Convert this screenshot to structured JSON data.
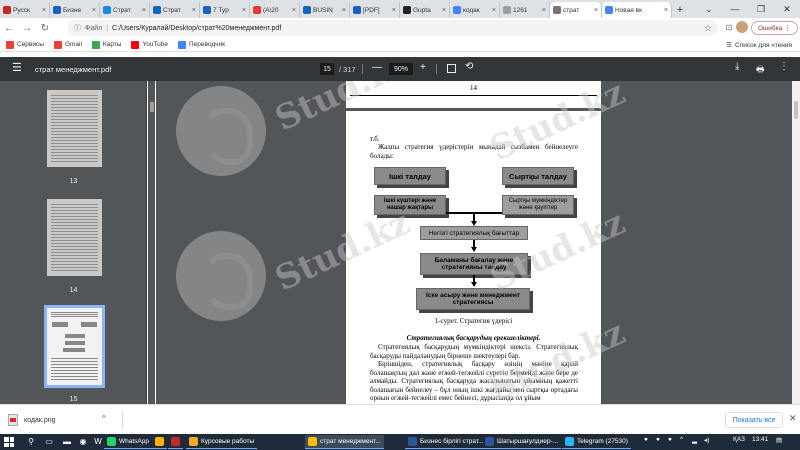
{
  "browser": {
    "tabs": [
      {
        "label": "Русск",
        "color": "#c62828"
      },
      {
        "label": "Бизне",
        "color": "#1565c0"
      },
      {
        "label": "Страт",
        "color": "#1e88e5"
      },
      {
        "label": "Страт",
        "color": "#1565c0"
      },
      {
        "label": "7 Тур",
        "color": "#1565c0"
      },
      {
        "label": "(А\\20",
        "color": "#e53935"
      },
      {
        "label": "BUSIN",
        "color": "#1565c0"
      },
      {
        "label": "[PDF]",
        "color": "#1565c0"
      },
      {
        "label": "Gupta",
        "color": "#212121"
      },
      {
        "label": "кодак",
        "color": "#4285f4"
      },
      {
        "label": "1261",
        "color": "#9e9e9e"
      }
    ],
    "active_tab": {
      "label": "страт",
      "color": "#757575"
    },
    "new_tab": {
      "label": "Новая вк",
      "color": "#4285f4"
    },
    "address": {
      "scheme_label": "Файл",
      "url": "C:/Users/Куралай/Desktop/страт%20менеджмент.pdf"
    },
    "error_label": "Ошибка",
    "bookmarks": [
      {
        "label": "Сервисы",
        "color": "#ea4335"
      },
      {
        "label": "Gmail",
        "color": "#ea4335"
      },
      {
        "label": "Карты",
        "color": "#34a853"
      },
      {
        "label": "YouTube",
        "color": "#ff0000"
      },
      {
        "label": "Переводчик",
        "color": "#4285f4"
      }
    ],
    "reading_list": "Список для чтения"
  },
  "pdf": {
    "title": "страт менеджмент.pdf",
    "current_page": "15",
    "total_pages": "/ 317",
    "zoom": "90%",
    "thumbnails": [
      {
        "num": "13"
      },
      {
        "num": "14"
      },
      {
        "num": "15"
      }
    ],
    "prev_page_number": "14",
    "page": {
      "ref": "т.б.",
      "intro": "Жалпы стратегия үдерістерін мынадай сызбамен бейнелеуге болады:",
      "boxes": {
        "internal": "Ішкі талдау",
        "external": "Сыртқы талдау",
        "strengths": "Ішкі күштері және нашар жақтары",
        "opportunities": "Сыртқы мүмкіндіктер және қауіптер",
        "basis": "Негізгі стратегиялық бағыттар",
        "evaluation": "Баламаны бағалау және стратегияны таңдау",
        "implementation": "Іске асыру және менеджмент стратегиясы"
      },
      "caption": "1-сурет.  Стратегия үдерісі",
      "heading": "Стратегиялық басқарудың ерекшеліктері.",
      "para1": "Стратегиялық басқарудың мүмкіндіктері шексіз. Стратегиялық басқаруды пайдаланудың бірнеше шектеулері бар.",
      "para2": "Біріншіден, стратегиялық басқару өзінің мәніне қарай болашақтың дәл және егжей-тегжейлі суретін бермейді және бере де алмайды. Стратегиялық басқаруда жасалынатын ұйымның қажетті болашағын бейнелеу – бұл оның ішкі жағдайы мен сыртқы ортадағы орнын егжей-тегжейлі емес бейнесі, дұрысында ол ұйым"
    },
    "watermark": "Stud.kz"
  },
  "downloads": {
    "filename": "кодак.png",
    "show_all": "Показать все"
  },
  "taskbar": {
    "apps": [
      {
        "label": "WhatsApp",
        "color": "#25d366"
      },
      {
        "label": "",
        "color": "#ffb300"
      },
      {
        "label": "",
        "color": "#c62828"
      },
      {
        "label": "Курсовые работы",
        "color": "#f9a825"
      },
      {
        "label": "страт менеджмент...",
        "color": "#fbbc04"
      },
      {
        "label": "Бизнес бірлігі страт...",
        "color": "#2b579a"
      },
      {
        "label": "Шатыршағулдиер-...",
        "color": "#2b579a"
      },
      {
        "label": "Telegram (27530)",
        "color": "#29b6f6"
      }
    ],
    "lang": "ҚАЗ",
    "time": "13:41"
  }
}
